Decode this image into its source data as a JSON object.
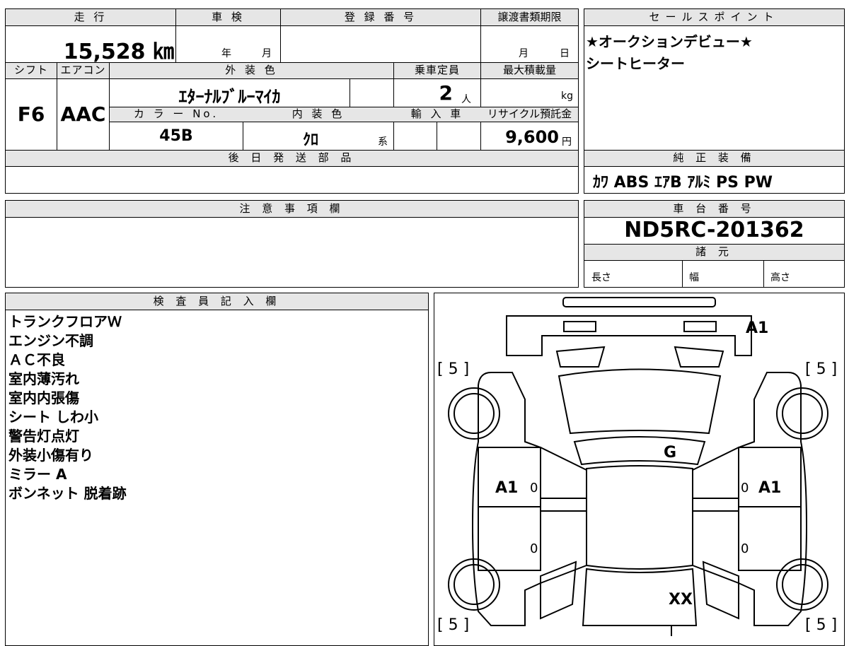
{
  "top_table": {
    "mileage_label": "走 行",
    "mileage_value": "15,528 ㎞",
    "inspection_label": "車 検",
    "inspection_year_unit": "年",
    "inspection_month_unit": "月",
    "registration_label": "登 録 番 号",
    "transfer_deadline_label": "譲渡書類期限",
    "transfer_month_unit": "月",
    "transfer_day_unit": "日",
    "shift_label": "シフト",
    "shift_value": "F6",
    "ac_label": "エアコン",
    "ac_value": "AAC",
    "exterior_color_label": "外 装 色",
    "exterior_color_value": "ｴﾀｰﾅﾙﾌﾞﾙｰﾏｲｶ",
    "capacity_label": "乗車定員",
    "capacity_value": "2",
    "capacity_unit": "人",
    "max_load_label": "最大積載量",
    "max_load_unit": "kg",
    "color_no_label": "カ ラ ー No.",
    "color_no_value": "45B",
    "interior_color_label": "内 装 色",
    "interior_color_value": "ｸﾛ",
    "interior_color_suffix": "系",
    "import_label": "輸 入 車",
    "recycle_label": "リサイクル預託金",
    "recycle_value": "9,600",
    "recycle_unit": "円",
    "later_parts_label": "後 日 発 送 部 品"
  },
  "sales_point": {
    "label": "セールスポイント",
    "lines": [
      "★オークションデビュー★",
      "シートヒーター"
    ]
  },
  "genuine_equipment": {
    "label": "純 正 装 備",
    "value": "ｶﾜ ABS ｴｱB ｱﾙﾐ PS PW"
  },
  "notes": {
    "label": "注 意 事 項 欄"
  },
  "chassis": {
    "label": "車 台 番 号",
    "value": "ND5RC-201362",
    "specs_label": "諸 元",
    "length_label": "長さ",
    "width_label": "幅",
    "height_label": "高さ"
  },
  "inspector": {
    "label": "検 査 員 記 入 欄",
    "lines": [
      "トランクフロアＷ",
      "エンジン不調",
      "ＡＣ不良",
      "室内薄汚れ",
      "室内内張傷",
      "シート しわ小",
      "警告灯点灯",
      "外装小傷有り",
      "ミラー A",
      "ボンネット 脱着跡"
    ]
  },
  "diagram": {
    "tire_marks": [
      "[ 5 ]",
      "[ 5 ]",
      "[ 5 ]",
      "[ 5 ]"
    ],
    "mark_trunk": "A1",
    "mark_left": "A1",
    "mark_right": "A1",
    "mark_glass": "G",
    "mark_hood": "XX",
    "zero_left_upper": "0",
    "zero_left_lower": "0",
    "zero_right_upper": "0",
    "zero_right_lower": "0"
  }
}
